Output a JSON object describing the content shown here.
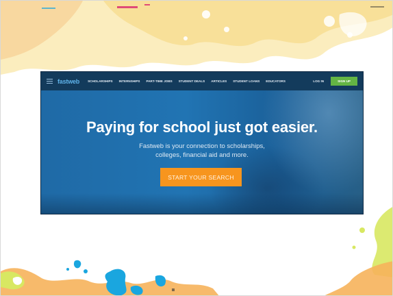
{
  "website": {
    "logo": "fastweb",
    "nav_links": [
      "SCHOLARSHIPS",
      "INTERNSHIPS",
      "PART-TIME JOBS",
      "STUDENT DEALS",
      "ARTICLES",
      "STUDENT LOANS",
      "EDUCATORS"
    ],
    "login_label": "LOG IN",
    "signup_label": "SIGN UP",
    "headline": "Paying for school just got easier.",
    "subtitle_line1": "Fastweb is your connection to scholarships,",
    "subtitle_line2": "colleges, financial aid and more.",
    "cta_label": "START YOUR SEARCH"
  },
  "colors": {
    "nav_bg": "#133b5c",
    "hero_blue": "#1f6aa6",
    "signup_green": "#64b544",
    "cta_orange": "#f7951e",
    "logo_blue": "#5fb3ea",
    "splash_yellow": "#f6e39a",
    "splash_orange": "#f6b25b",
    "splash_green": "#d8e862",
    "splash_cyan": "#1aa6df",
    "splash_magenta": "#d8266e"
  }
}
